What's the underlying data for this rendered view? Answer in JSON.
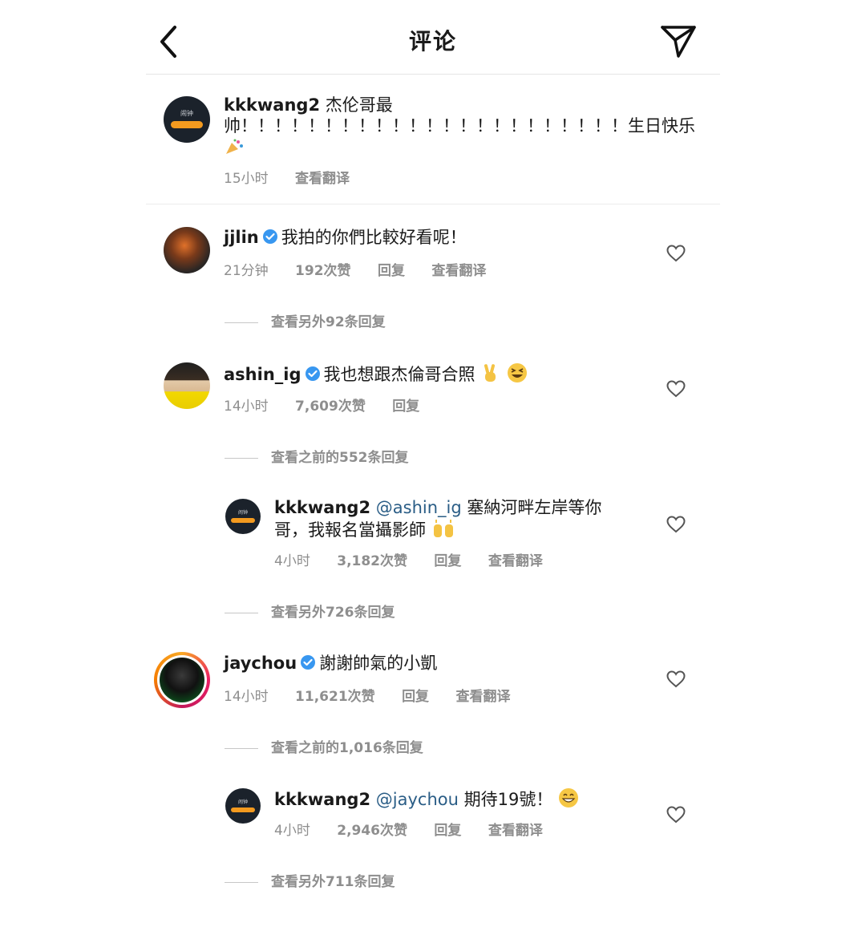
{
  "header": {
    "title": "评论"
  },
  "caption": {
    "username": "kkkwang2",
    "text": "杰伦哥最帅！！！！！！！！！！！！！！！！！！！！！！！生日快乐",
    "time": "15小时",
    "translate": "查看翻译",
    "avatar_text": "闹钟"
  },
  "comments": [
    {
      "username": "jjlin",
      "text": "我拍的你們比較好看呢！",
      "time": "21分钟",
      "likes": "192次赞",
      "reply": "回复",
      "translate": "查看翻译",
      "more_replies": "查看另外92条回复"
    },
    {
      "username": "ashin_ig",
      "text": "我也想跟杰倫哥合照",
      "time": "14小时",
      "likes": "7,609次赞",
      "reply": "回复",
      "more_replies": "查看之前的552条回复",
      "replies": [
        {
          "username": "kkkwang2",
          "mention": "@ashin_ig",
          "text": "塞納河畔左岸等你哥，我報名當攝影師",
          "time": "4小时",
          "likes": "3,182次赞",
          "reply": "回复",
          "translate": "查看翻译",
          "more_replies": "查看另外726条回复"
        }
      ]
    },
    {
      "username": "jaychou",
      "text": "謝謝帥氣的小凱",
      "time": "14小时",
      "likes": "11,621次赞",
      "reply": "回复",
      "translate": "查看翻译",
      "more_replies": "查看之前的1,016条回复",
      "replies": [
        {
          "username": "kkkwang2",
          "mention": "@jaychou",
          "text": "期待19號！",
          "time": "4小时",
          "likes": "2,946次赞",
          "reply": "回复",
          "translate": "查看翻译",
          "more_replies": "查看另外711条回复"
        }
      ]
    }
  ],
  "icons": {
    "back": "chevron-left-icon",
    "share": "paper-plane-icon",
    "like": "heart-outline-icon",
    "verified": "verified-badge-icon",
    "verified_color": "#3897f0",
    "clock_accent": "#f39a1f"
  }
}
